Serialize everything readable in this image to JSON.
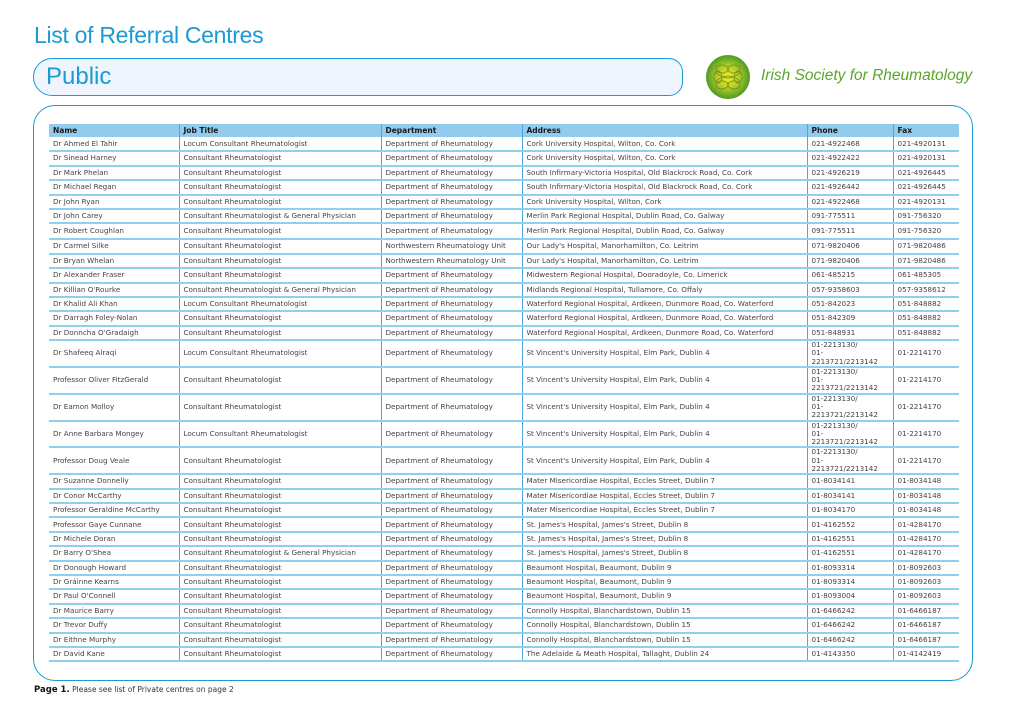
{
  "document": {
    "title": "List of Referral Centres",
    "section": "Public",
    "organisation": "Irish Society for Rheumatology",
    "logo_icon": "celtic-knot-logo",
    "colors": {
      "accent": "#1b9ad6",
      "header_fill": "#93cbee",
      "brand_green": "#5aa62c"
    }
  },
  "table": {
    "columns": [
      "Name",
      "Job Title",
      "Department",
      "Address",
      "Phone",
      "Fax"
    ],
    "rows": [
      {
        "name": "Dr Ahmed El Tahir",
        "job": "Locum Consultant Rheumatologist",
        "dept": "Department of Rheumatology",
        "address": "Cork University Hospital, Wilton, Co. Cork",
        "phone": "021-4922468",
        "fax": "021-4920131"
      },
      {
        "name": "Dr Sinead Harney",
        "job": "Consultant Rheumatologist",
        "dept": "Department of Rheumatology",
        "address": "Cork University Hospital, Wilton, Co. Cork",
        "phone": "021-4922422",
        "fax": "021-4920131"
      },
      {
        "name": "Dr Mark Phelan",
        "job": "Consultant Rheumatologist",
        "dept": "Department of Rheumatology",
        "address": "South Infirmary-Victoria Hospital, Old Blackrock Road, Co. Cork",
        "phone": "021-4926219",
        "fax": "021-4926445"
      },
      {
        "name": "Dr Michael Regan",
        "job": "Consultant Rheumatologist",
        "dept": "Department of Rheumatology",
        "address": "South Infirmary-Victoria Hospital, Old Blackrock Road, Co. Cork",
        "phone": "021-4926442",
        "fax": "021-4926445"
      },
      {
        "name": "Dr John Ryan",
        "job": "Consultant Rheumatologist",
        "dept": "Department of Rheumatology",
        "address": "Cork University Hospital, Wilton, Cork",
        "phone": "021-4922468",
        "fax": "021-4920131"
      },
      {
        "name": "Dr John Carey",
        "job": "Consultant Rheumatologist & General Physician",
        "dept": "Department of Rheumatology",
        "address": "Merlin Park Regional Hospital, Dublin Road, Co. Galway",
        "phone": "091-775511",
        "fax": "091-756320"
      },
      {
        "name": "Dr Robert Coughlan",
        "job": "Consultant Rheumatologist",
        "dept": "Department of Rheumatology",
        "address": "Merlin Park Regional Hospital, Dublin Road, Co. Galway",
        "phone": "091-775511",
        "fax": "091-756320"
      },
      {
        "name": "Dr Carmel Silke",
        "job": "Consultant Rheumatologist",
        "dept": "Northwestern Rheumatology Unit",
        "address": "Our Lady's Hospital, Manorhamilton, Co. Leitrim",
        "phone": "071-9820406",
        "fax": "071-9820486"
      },
      {
        "name": "Dr Bryan Whelan",
        "job": "Consultant Rheumatologist",
        "dept": "Northwestern Rheumatology Unit",
        "address": "Our Lady's Hospital, Manorhamilton, Co. Leitrim",
        "phone": "071-9820406",
        "fax": "071-9820486"
      },
      {
        "name": "Dr Alexander Fraser",
        "job": "Consultant Rheumatologist",
        "dept": "Department of Rheumatology",
        "address": "Midwestern Regional Hospital, Dooradoyle, Co. Limerick",
        "phone": "061-485215",
        "fax": "061-485305"
      },
      {
        "name": "Dr Killian O'Rourke",
        "job": "Consultant Rheumatologist & General Physician",
        "dept": "Department of Rheumatology",
        "address": "Midlands Regional Hospital, Tullamore, Co. Offaly",
        "phone": "057-9358603",
        "fax": "057-9358612"
      },
      {
        "name": "Dr Khalid Ali Khan",
        "job": "Locum Consultant Rheumatologist",
        "dept": "Department of Rheumatology",
        "address": "Waterford Regional Hospital, Ardkeen, Dunmore Road, Co. Waterford",
        "phone": "051-842023",
        "fax": "051-848882"
      },
      {
        "name": "Dr Darragh Foley-Nolan",
        "job": "Consultant Rheumatologist",
        "dept": "Department of Rheumatology",
        "address": "Waterford Regional Hospital, Ardkeen, Dunmore Road, Co. Waterford",
        "phone": "051-842309",
        "fax": "051-848882"
      },
      {
        "name": "Dr Donncha O'Gradaigh",
        "job": "Consultant Rheumatologist",
        "dept": "Department of Rheumatology",
        "address": "Waterford Regional Hospital, Ardkeen, Dunmore Road, Co. Waterford",
        "phone": "051-848931",
        "fax": "051-848882"
      },
      {
        "name": "Dr Shafeeq Alraqi",
        "job": "Locum Consultant Rheumatologist",
        "dept": "Department of Rheumatology",
        "address": "St Vincent's University Hospital, Elm Park, Dublin 4",
        "phone": "01-2213130/ 01-2213721/2213142",
        "fax": "01-2214170"
      },
      {
        "name": "Professor Oliver FitzGerald",
        "job": "Consultant Rheumatologist",
        "dept": "Department of Rheumatology",
        "address": "St Vincent's University Hospital, Elm Park, Dublin 4",
        "phone": "01-2213130/ 01-2213721/2213142",
        "fax": "01-2214170"
      },
      {
        "name": "Dr Eamon Molloy",
        "job": "Consultant Rheumatologist",
        "dept": "Department of Rheumatology",
        "address": "St Vincent's University Hospital, Elm Park, Dublin 4",
        "phone": "01-2213130/ 01-2213721/2213142",
        "fax": "01-2214170"
      },
      {
        "name": "Dr Anne Barbara Mongey",
        "job": "Locum Consultant Rheumatologist",
        "dept": "Department of Rheumatology",
        "address": "St Vincent's University Hospital, Elm Park, Dublin 4",
        "phone": "01-2213130/ 01-2213721/2213142",
        "fax": "01-2214170"
      },
      {
        "name": "Professor Doug Veale",
        "job": "Consultant Rheumatologist",
        "dept": "Department of Rheumatology",
        "address": "St Vincent's University Hospital, Elm Park, Dublin 4",
        "phone": "01-2213130/ 01-2213721/2213142",
        "fax": "01-2214170"
      },
      {
        "name": "Dr Suzanne Donnelly",
        "job": "Consultant Rheumatologist",
        "dept": "Department of Rheumatology",
        "address": "Mater Misericordiae Hospital, Eccles Street, Dublin 7",
        "phone": "01-8034141",
        "fax": "01-8034148"
      },
      {
        "name": "Dr Conor McCarthy",
        "job": "Consultant Rheumatologist",
        "dept": "Department of Rheumatology",
        "address": "Mater Misericordiae Hospital, Eccles Street, Dublin 7",
        "phone": "01-8034141",
        "fax": "01-8034148"
      },
      {
        "name": "Professor Geraldine McCarthy",
        "job": "Consultant Rheumatologist",
        "dept": "Department of Rheumatology",
        "address": "Mater Misericordiae Hospital, Eccles Street, Dublin 7",
        "phone": "01-8034170",
        "fax": "01-8034148"
      },
      {
        "name": "Professor Gaye Cunnane",
        "job": "Consultant Rheumatologist",
        "dept": "Department of Rheumatology",
        "address": "St. James's Hospital, James's Street, Dublin 8",
        "phone": "01-4162552",
        "fax": "01-4284170"
      },
      {
        "name": "Dr Michele Doran",
        "job": "Consultant Rheumatologist",
        "dept": "Department of Rheumatology",
        "address": "St. James's Hospital, James's Street, Dublin 8",
        "phone": "01-4162551",
        "fax": "01-4284170"
      },
      {
        "name": "Dr Barry O'Shea",
        "job": "Consultant Rheumatologist & General Physician",
        "dept": "Department of Rheumatology",
        "address": "St. James's Hospital, James's Street, Dublin 8",
        "phone": "01-4162551",
        "fax": "01-4284170"
      },
      {
        "name": "Dr Donough Howard",
        "job": "Consultant Rheumatologist",
        "dept": "Department of Rheumatology",
        "address": "Beaumont Hospital, Beaumont, Dublin 9",
        "phone": "01-8093314",
        "fax": "01-8092603"
      },
      {
        "name": "Dr Gráinne Kearns",
        "job": "Consultant Rheumatologist",
        "dept": "Department of Rheumatology",
        "address": "Beaumont Hospital, Beaumont, Dublin 9",
        "phone": "01-8093314",
        "fax": "01-8092603"
      },
      {
        "name": "Dr Paul O'Connell",
        "job": "Consultant Rheumatologist",
        "dept": "Department of Rheumatology",
        "address": "Beaumont Hospital, Beaumont, Dublin 9",
        "phone": "01-8093004",
        "fax": "01-8092603"
      },
      {
        "name": "Dr Maurice Barry",
        "job": "Consultant Rheumatologist",
        "dept": "Department of Rheumatology",
        "address": "Connolly Hospital, Blanchardstown, Dublin 15",
        "phone": "01-6466242",
        "fax": "01-6466187"
      },
      {
        "name": "Dr Trevor Duffy",
        "job": "Consultant Rheumatologist",
        "dept": "Department of Rheumatology",
        "address": "Connolly Hospital, Blanchardstown, Dublin 15",
        "phone": "01-6466242",
        "fax": "01-6466187"
      },
      {
        "name": "Dr Eithne Murphy",
        "job": "Consultant Rheumatologist",
        "dept": "Department of Rheumatology",
        "address": "Connolly Hospital, Blanchardstown, Dublin 15",
        "phone": "01-6466242",
        "fax": "01-6466187"
      },
      {
        "name": "Dr David  Kane",
        "job": "Consultant Rheumatologist",
        "dept": "Department of Rheumatology",
        "address": "The Adelaide & Meath Hospital, Tallaght, Dublin 24",
        "phone": "01-4143350",
        "fax": "01-4142419"
      }
    ]
  },
  "footer": {
    "page_label": "Page 1.",
    "note": "Please see list of Private centres on page 2"
  }
}
